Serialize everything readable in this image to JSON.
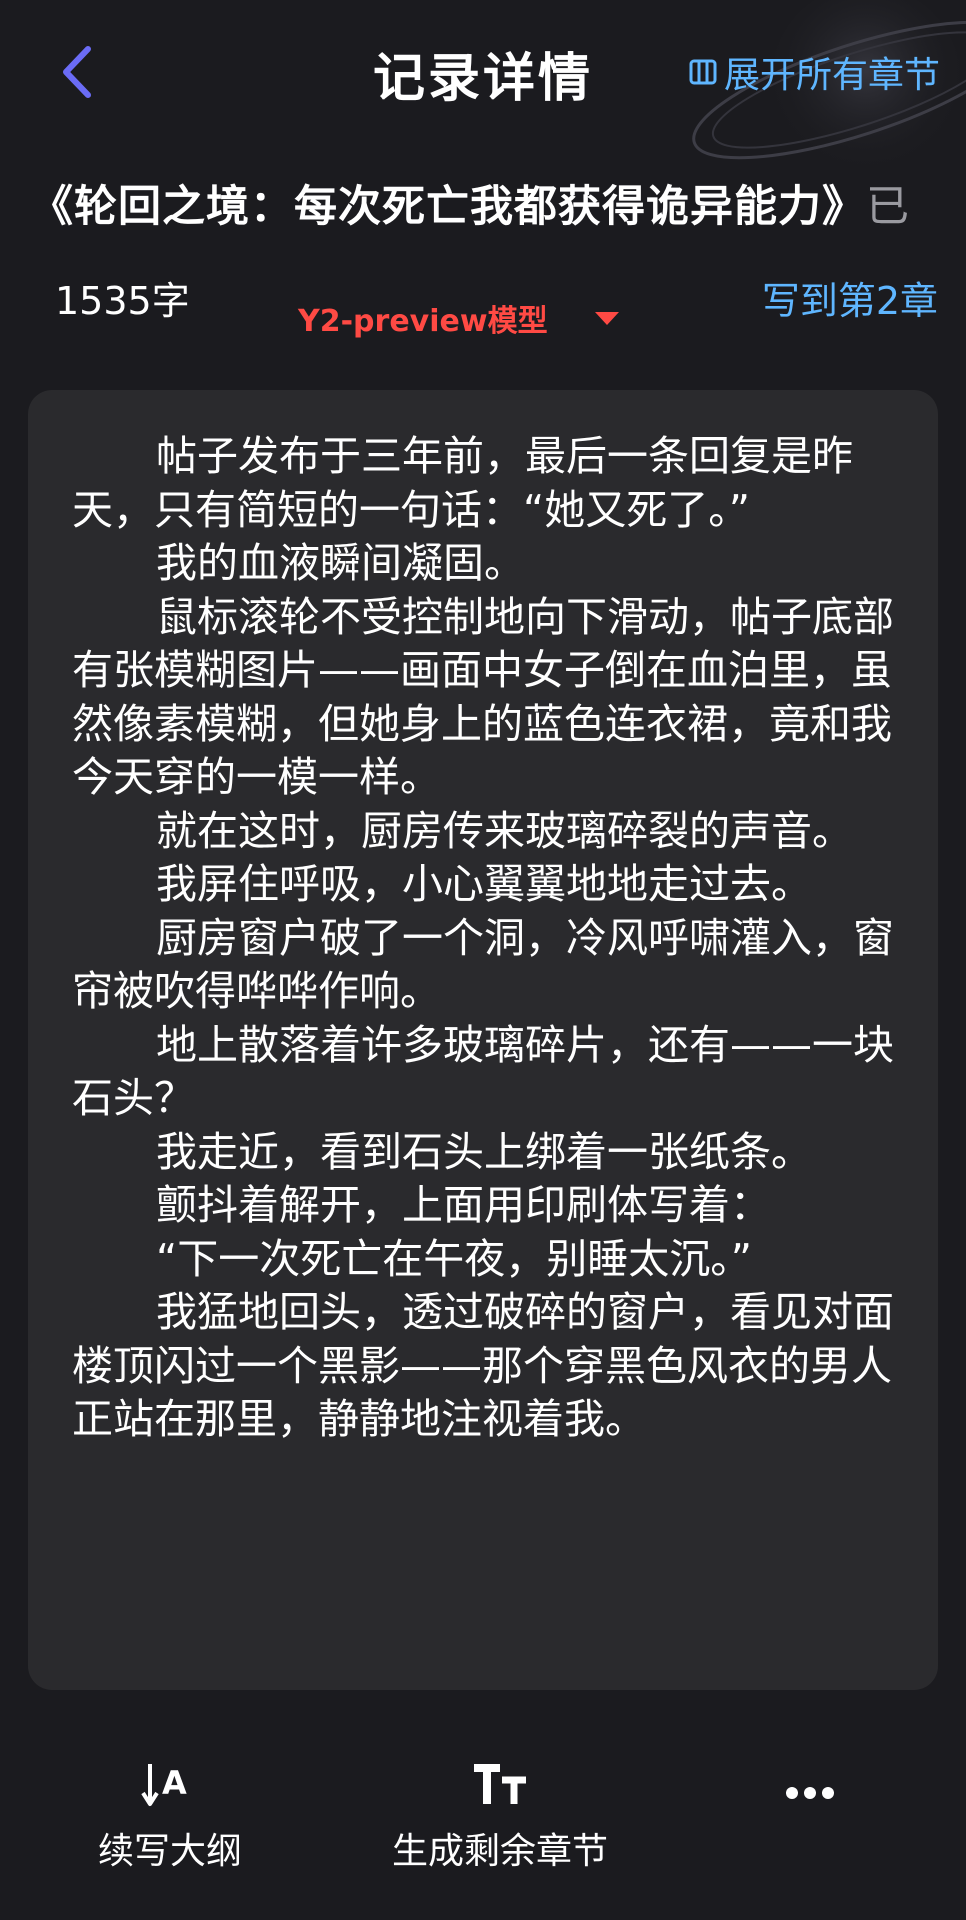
{
  "header": {
    "back_label": "",
    "title": "记录详情",
    "expand_label": "展开所有章节"
  },
  "book": {
    "title": "《轮回之境：每次死亡我都获得诡异能力》",
    "title_tail": "已"
  },
  "info": {
    "word_count": "1535字",
    "model": "Y2-preview模型",
    "written_to": "写到第2章"
  },
  "content": {
    "paragraphs": [
      "帖子发布于三年前，最后一条回复是昨天，只有简短的一句话：“她又死了。”",
      "我的血液瞬间凝固。",
      "鼠标滚轮不受控制地向下滑动，帖子底部有张模糊图片——画面中女子倒在血泊里，虽然像素模糊，但她身上的蓝色连衣裙，竟和我今天穿的一模一样。",
      "就在这时，厨房传来玻璃碎裂的声音。",
      "我屏住呼吸，小心翼翼地地走过去。",
      "厨房窗户破了一个洞，冷风呼啸灌入，窗帘被吹得哗哗作响。",
      "地上散落着许多玻璃碎片，还有——一块石头？",
      "我走近，看到石头上绑着一张纸条。",
      "颤抖着解开，上面用印刷体写着：",
      "“下一次死亡在午夜，别睡太沉。”",
      "我猛地回头，透过破碎的窗户，看见对面楼顶闪过一个黑影——那个穿黑色风衣的男人正站在那里，静静地注视着我。"
    ]
  },
  "toolbar": {
    "outline_label": "续写大纲",
    "outline_icon": "sort-down-a-icon",
    "generate_label": "生成剩余章节",
    "generate_icon": "text-size-icon",
    "more_icon": "more-dots-icon"
  },
  "colors": {
    "background": "#1b1b1f",
    "card": "#2a2a2d",
    "accent_blue": "#5fb6ff",
    "model_red": "#ff4a44",
    "back_purple": "#6b6cf6"
  }
}
